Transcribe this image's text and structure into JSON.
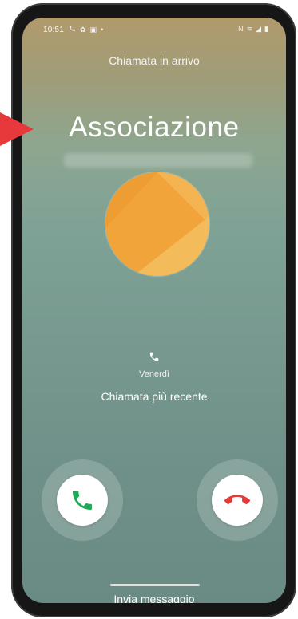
{
  "statusbar": {
    "time": "10:51",
    "left_icons": [
      "phone-icon",
      "gear-icon",
      "image-icon",
      "dot-icon"
    ],
    "right_icons": [
      "mute-icon",
      "wifi-icon",
      "signal-icon",
      "battery-icon"
    ]
  },
  "call": {
    "incoming_label": "Chiamata in arrivo",
    "caller_name": "Associazione",
    "recent_day": "Venerdì",
    "recent_label": "Chiamata più recente"
  },
  "actions": {
    "accept_icon": "phone-accept-icon",
    "decline_icon": "phone-decline-icon",
    "accept_color": "#1faa59",
    "decline_color": "#e53935"
  },
  "bottom": {
    "send_message": "Invia messaggio"
  },
  "colors": {
    "avatar_orange": "#f1a43a",
    "arrow_red": "#e7383b"
  }
}
